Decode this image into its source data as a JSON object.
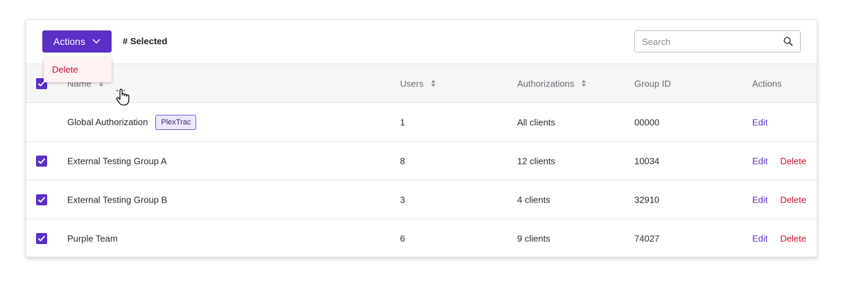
{
  "toolbar": {
    "actions_label": "Actions",
    "selected_label": "# Selected",
    "search_placeholder": "Search"
  },
  "dropdown": {
    "items": [
      {
        "label": "Delete"
      }
    ]
  },
  "table": {
    "columns": {
      "name": "Name",
      "users": "Users",
      "authorizations": "Authorizations",
      "group_id": "Group ID",
      "actions": "Actions"
    },
    "rows": [
      {
        "name": "Global Authorization",
        "badge": "PlexTrac",
        "users": "1",
        "authorizations": "All clients",
        "group_id": "00000",
        "edit": "Edit",
        "checked": false
      },
      {
        "name": "External Testing Group A",
        "users": "8",
        "authorizations": "12 clients",
        "group_id": "10034",
        "edit": "Edit",
        "delete": "Delete",
        "checked": true
      },
      {
        "name": "External Testing Group B",
        "users": "3",
        "authorizations": "4 clients",
        "group_id": "32910",
        "edit": "Edit",
        "delete": "Delete",
        "checked": true
      },
      {
        "name": "Purple Team",
        "users": "6",
        "authorizations": "9 clients",
        "group_id": "74027",
        "edit": "Edit",
        "delete": "Delete",
        "checked": true
      }
    ]
  },
  "colors": {
    "accent": "#5b30c7",
    "danger": "#c8102e",
    "header_bg": "#f6f6f7"
  },
  "icons": {
    "actions_chevron": "chevron-down-icon",
    "search": "search-icon",
    "sort": "sort-icon",
    "checkbox": "checkmark-icon",
    "cursor": "hand-pointer-icon"
  }
}
